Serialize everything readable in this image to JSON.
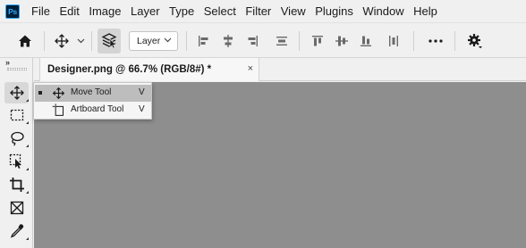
{
  "app": {
    "logo_text": "Ps"
  },
  "menu": [
    "File",
    "Edit",
    "Image",
    "Layer",
    "Type",
    "Select",
    "Filter",
    "View",
    "Plugins",
    "Window",
    "Help"
  ],
  "options": {
    "auto_select_target": "Layer"
  },
  "toolbar": {
    "collapse_glyph": "»",
    "tools": [
      {
        "name": "move-tool",
        "icon": "move-icon",
        "active": true
      },
      {
        "name": "rectangular-marquee-tool",
        "icon": "marquee-icon",
        "active": false
      },
      {
        "name": "lasso-tool",
        "icon": "lasso-icon",
        "active": false
      },
      {
        "name": "object-selection-tool",
        "icon": "object-selection-icon",
        "active": false
      },
      {
        "name": "crop-tool",
        "icon": "crop-icon",
        "active": false
      },
      {
        "name": "frame-tool",
        "icon": "frame-icon",
        "active": false
      },
      {
        "name": "eyedropper-tool",
        "icon": "eyedropper-icon",
        "active": false
      }
    ]
  },
  "document": {
    "tab_title": "Designer.png @ 66.7% (RGB/8#) *",
    "close_glyph": "×",
    "canvas_color": "#8e8e8e"
  },
  "flyout": {
    "items": [
      {
        "label": "Move Tool",
        "shortcut": "V",
        "icon": "move-icon",
        "selected": true
      },
      {
        "label": "Artboard Tool",
        "shortcut": "V",
        "icon": "artboard-icon",
        "selected": false
      }
    ]
  }
}
